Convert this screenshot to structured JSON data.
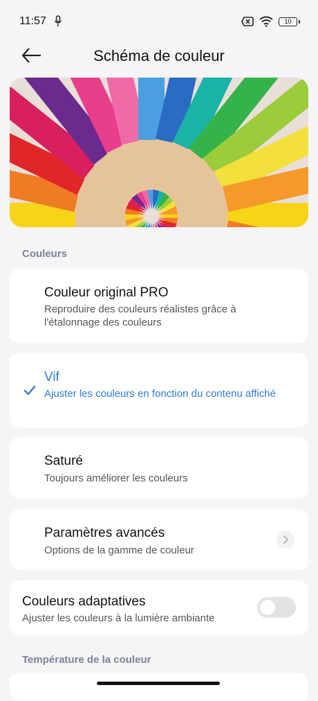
{
  "status_bar": {
    "time": "11:57",
    "battery": "10"
  },
  "header": {
    "title": "Schéma de couleur"
  },
  "sections": {
    "colors": "Couleurs",
    "temperature": "Température de la couleur"
  },
  "options": [
    {
      "title": "Couleur original PRO",
      "subtitle": "Reproduire des couleurs réalistes grâce à l'étalonnage des couleurs",
      "selected": false
    },
    {
      "title": "Vif",
      "subtitle": "Ajuster les couleurs en fonction du contenu affiché",
      "selected": true
    },
    {
      "title": "Saturé",
      "subtitle": "Toujours améliorer les couleurs",
      "selected": false
    }
  ],
  "advanced": {
    "title": "Paramètres avancés",
    "subtitle": "Options de la gamme de couleur"
  },
  "adaptive": {
    "title": "Couleurs adaptatives",
    "subtitle": "Ajuster les couleurs à la lumière ambiante",
    "enabled": false
  },
  "colors": {
    "accent": "#2e7ad8",
    "background": "#f5f5f7",
    "section_label": "#7b8299"
  }
}
